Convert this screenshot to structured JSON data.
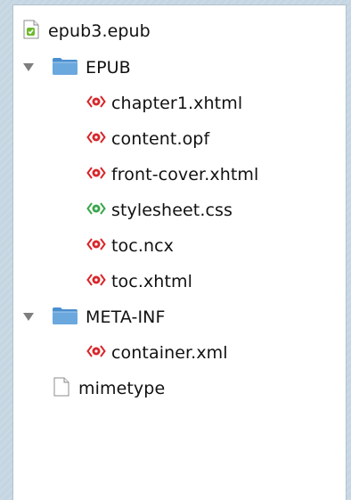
{
  "tree": {
    "root_file": {
      "label": "epub3.epub",
      "icon": "epub-file-icon"
    },
    "folders": [
      {
        "label": "EPUB",
        "icon": "folder-icon",
        "expanded": true,
        "children": [
          {
            "label": "chapter1.xhtml",
            "icon": "xml-tag-icon",
            "color": "#d8262a"
          },
          {
            "label": "content.opf",
            "icon": "xml-tag-icon",
            "color": "#d8262a"
          },
          {
            "label": "front-cover.xhtml",
            "icon": "xml-tag-icon",
            "color": "#d8262a"
          },
          {
            "label": "stylesheet.css",
            "icon": "css-tag-icon",
            "color": "#3aa64a"
          },
          {
            "label": "toc.ncx",
            "icon": "xml-tag-icon",
            "color": "#d8262a"
          },
          {
            "label": "toc.xhtml",
            "icon": "xml-tag-icon",
            "color": "#d8262a"
          }
        ]
      },
      {
        "label": "META-INF",
        "icon": "folder-icon",
        "expanded": true,
        "children": [
          {
            "label": "container.xml",
            "icon": "xml-tag-icon",
            "color": "#d8262a"
          }
        ]
      }
    ],
    "trailing_file": {
      "label": "mimetype",
      "icon": "blank-file-icon"
    }
  },
  "colors": {
    "xml_red": "#d8262a",
    "css_green": "#3aa64a",
    "folder_blue": "#4a8fcf",
    "epub_green": "#6cba2c"
  }
}
